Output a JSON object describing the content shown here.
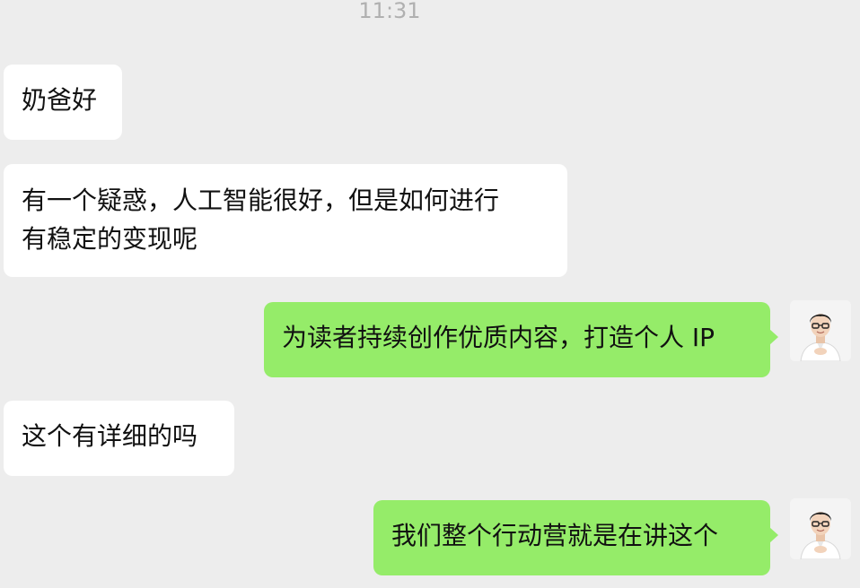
{
  "status": {
    "time": "11:31"
  },
  "messages": [
    {
      "side": "left",
      "lines": [
        "奶爸好"
      ]
    },
    {
      "side": "left",
      "lines": [
        "有一个疑惑，人工智能很好，但是如何进行",
        "有稳定的变现呢"
      ]
    },
    {
      "side": "right",
      "lines": [
        "为读者持续创作优质内容，打造个人 IP"
      ]
    },
    {
      "side": "left",
      "lines": [
        "这个有详细的吗"
      ]
    },
    {
      "side": "right",
      "lines": [
        "我们整个行动营就是在讲这个"
      ]
    }
  ],
  "colors": {
    "background": "#ededed",
    "incoming_bubble": "#ffffff",
    "outgoing_bubble": "#95ec69",
    "timestamp": "#b0b0b0"
  },
  "icons": {
    "self_avatar": "avatar-man-glasses-icon"
  }
}
